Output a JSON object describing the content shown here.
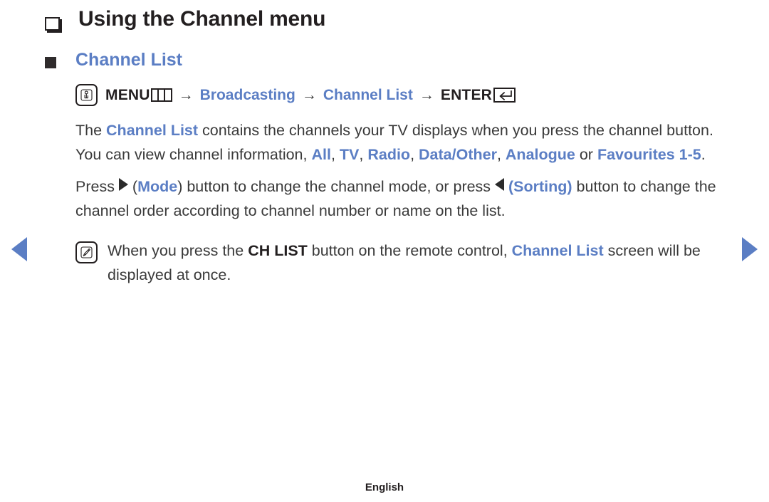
{
  "page": {
    "heading": "Using the Channel menu",
    "subheading": "Channel List",
    "footer_label": "English"
  },
  "menu_path": {
    "icon_name": "oo-press-button-icon",
    "menu_label": "MENU",
    "menu_grid_icon": "menu-grid-icon",
    "arrow1": "→",
    "step_broadcasting": "Broadcasting",
    "arrow2": "→",
    "step_channel_list": "Channel List",
    "arrow3": "→",
    "enter_label": "ENTER",
    "enter_icon": "enter-return-icon"
  },
  "paragraph_1": {
    "t1": "The ",
    "b1": "Channel List",
    "t2": " contains the channels your TV displays when you press the channel button. You can view channel information, ",
    "b2": "All",
    "t3": ", ",
    "b3": "TV",
    "t4": ", ",
    "b4": "Radio",
    "t5": ", ",
    "b5": "Data/Other",
    "t6": ", ",
    "b6": "Analogue",
    "t7": " or ",
    "b7": "Favourites 1-5",
    "t8": "."
  },
  "paragraph_2": {
    "t1": "Press ",
    "icon1": "triangle-right-icon",
    "t2": " (",
    "b1": "Mode",
    "t3": ") button to change the channel mode, or press ",
    "icon2": "triangle-left-icon",
    "t4": " ",
    "b2": "(Sorting)",
    "t5": " button to change the channel order according to channel number or name on the list."
  },
  "note": {
    "icon_name": "note-pencil-icon",
    "t1": "When you press the ",
    "b1": "CH LIST",
    "t2": " button on the remote control, ",
    "b2": "Channel List",
    "t3": " screen will be displayed at once."
  },
  "navigation": {
    "prev_label": "◀",
    "next_label": "▶"
  },
  "colors": {
    "accent_blue": "#5b7ec4",
    "text_dark": "#231f20",
    "body_text": "#3a3a3a"
  }
}
